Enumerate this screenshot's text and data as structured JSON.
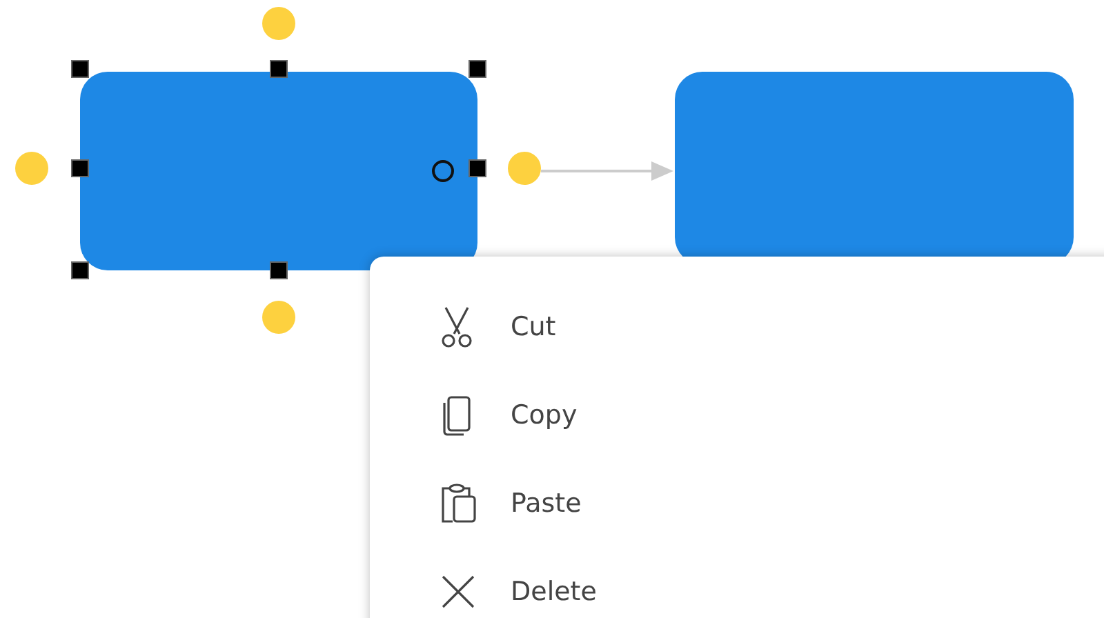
{
  "canvas": {
    "nodes": [
      {
        "selected": true
      },
      {
        "selected": false
      }
    ]
  },
  "context_menu": {
    "items": [
      {
        "kind": "cut",
        "label": "Cut"
      },
      {
        "kind": "copy",
        "label": "Copy"
      },
      {
        "kind": "paste",
        "label": "Paste"
      },
      {
        "kind": "delete",
        "label": "Delete"
      }
    ]
  }
}
